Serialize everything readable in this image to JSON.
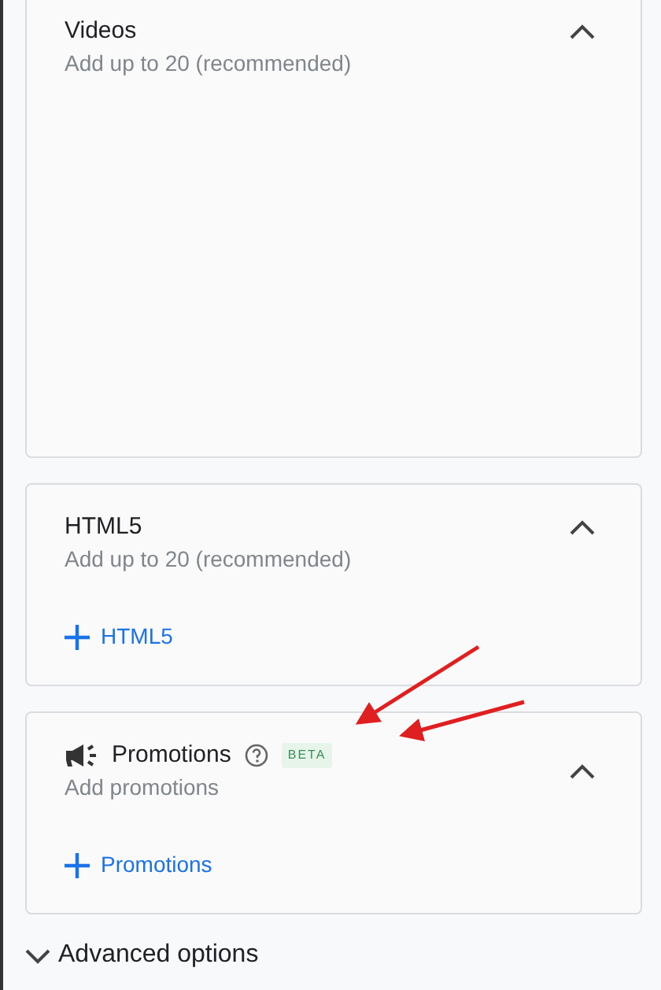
{
  "sections": [
    {
      "kind": "media",
      "title": "Videos",
      "subtitle": "Add up to 20 (recommended)",
      "expanded": true
    },
    {
      "kind": "media",
      "title": "HTML5",
      "subtitle": "Add up to 20 (recommended)",
      "expanded": true,
      "add_label": "HTML5"
    },
    {
      "kind": "promo",
      "title": "Promotions",
      "subtitle": "Add promotions",
      "expanded": true,
      "add_label": "Promotions",
      "badge": "BETA"
    }
  ],
  "advanced_options": {
    "label": "Advanced options",
    "expanded": false
  }
}
